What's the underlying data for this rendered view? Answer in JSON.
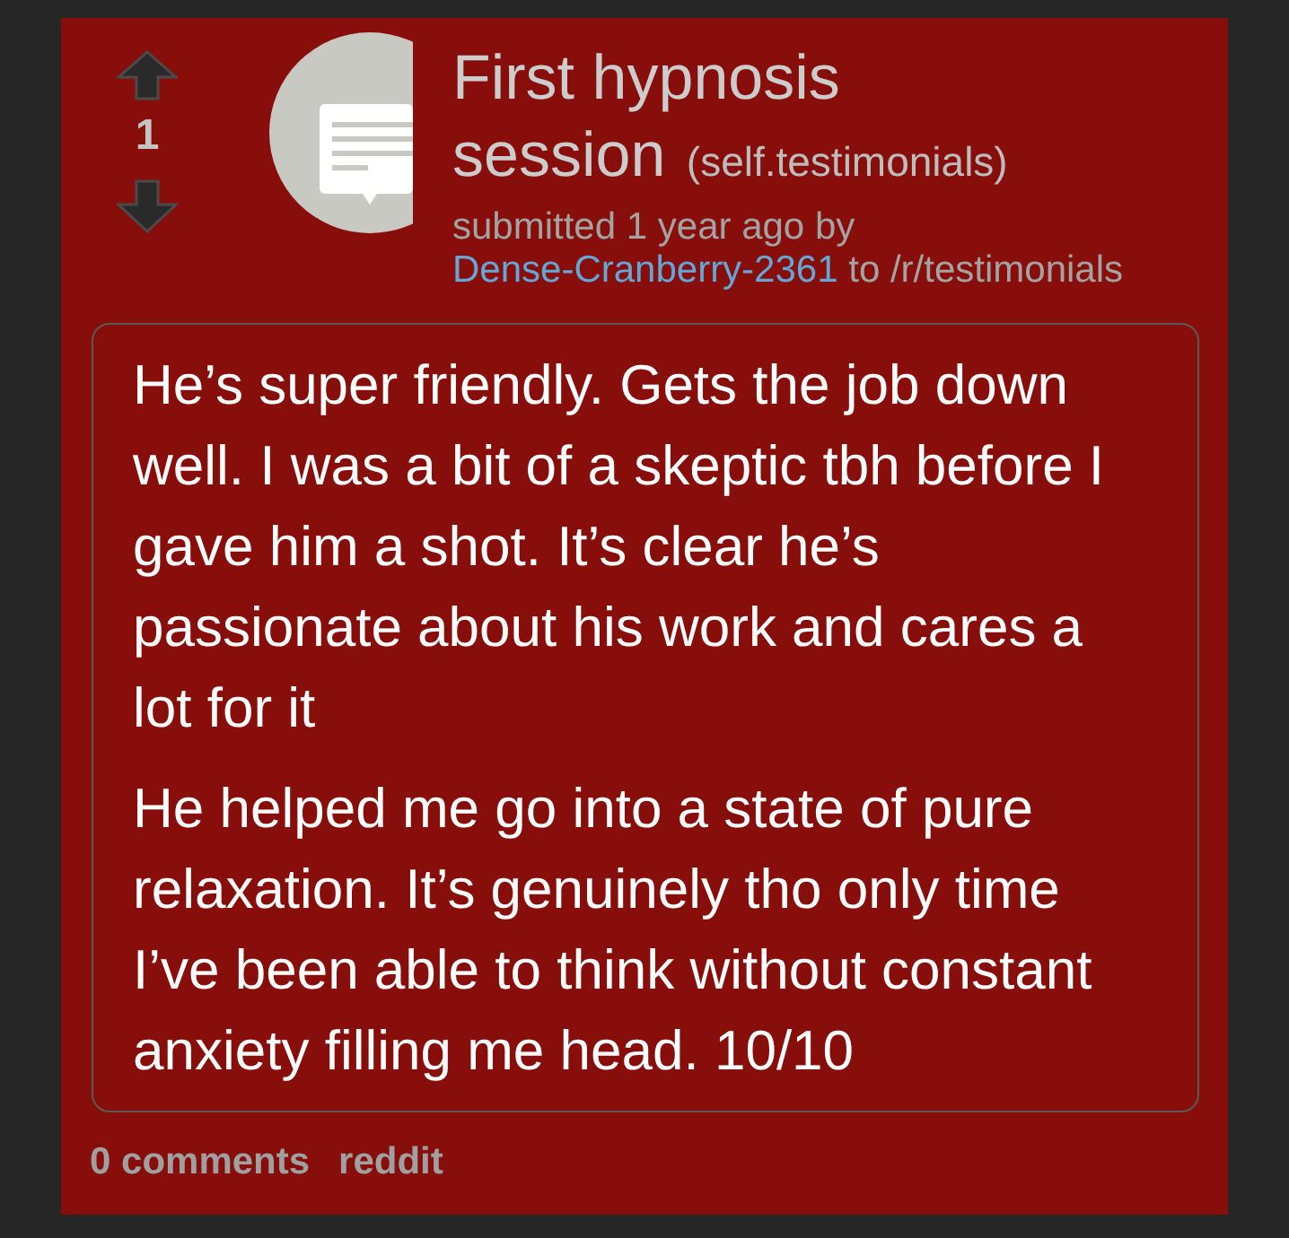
{
  "vote": {
    "score": "1"
  },
  "post": {
    "title": "First hypnosis session",
    "domain": "(self.testimonials)",
    "tagline": {
      "prefix": "submitted 1 year ago by",
      "author": "Dense-Cranberry-2361",
      "suffix": "to /r/testimonials"
    },
    "body": [
      "He’s super friendly. Gets the job down well. I was a bit of a skeptic tbh before I gave him a shot. It’s clear he’s passionate about his work and cares a lot for it",
      "He helped me go into a state of pure relaxation. It’s genuinely tho only time I’ve been able to think without constant anxiety filling me head. 10/10"
    ]
  },
  "buttons": [
    "0 comments",
    "reddit"
  ]
}
